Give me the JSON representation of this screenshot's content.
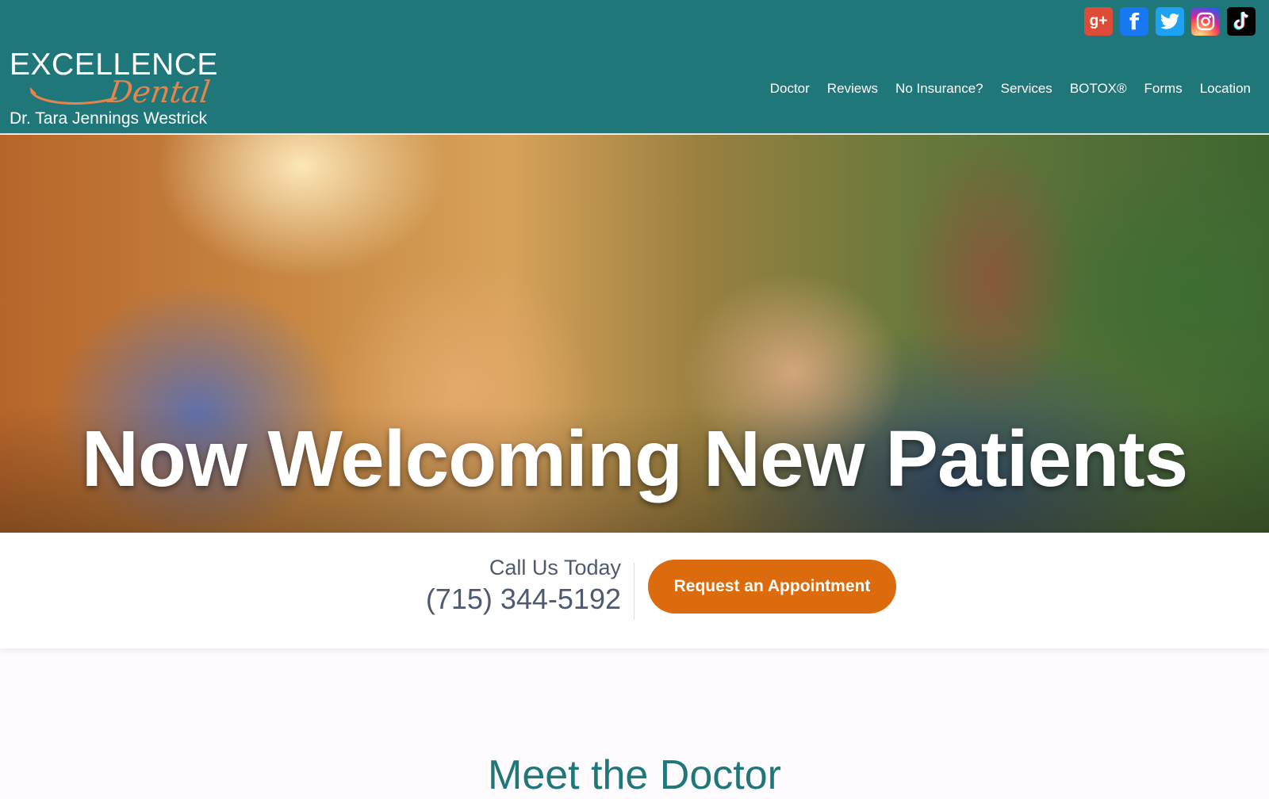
{
  "brand": {
    "line1": "EXCELLENCE",
    "line2": "Dental",
    "line3": "Dr. Tara Jennings Westrick",
    "colors": {
      "teal": "#20777a",
      "orange": "#db6b0c"
    }
  },
  "social": [
    {
      "name": "google-plus-icon",
      "glyph": "g+"
    },
    {
      "name": "facebook-icon",
      "glyph": "f"
    },
    {
      "name": "twitter-icon",
      "glyph": ""
    },
    {
      "name": "instagram-icon",
      "glyph": ""
    },
    {
      "name": "tiktok-icon",
      "glyph": ""
    }
  ],
  "nav": [
    "Doctor",
    "Reviews",
    "No Insurance?",
    "Services",
    "BOTOX®",
    "Forms",
    "Location"
  ],
  "hero": {
    "title": "Now Welcoming New Patients"
  },
  "cta": {
    "call_label": "Call Us Today",
    "phone": "(715) 344-5192",
    "button": "Request an Appointment"
  },
  "section": {
    "title": "Meet the Doctor"
  }
}
